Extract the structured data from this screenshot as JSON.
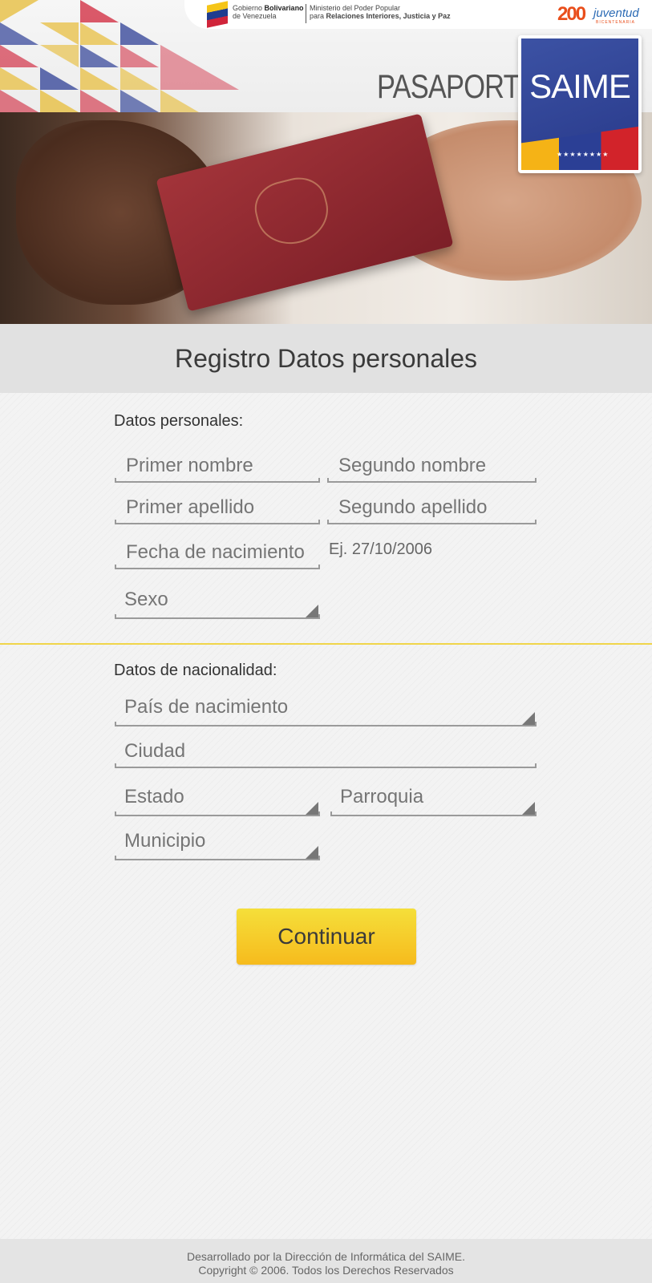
{
  "header": {
    "gov_line1_bold": "Bolivariano",
    "gov_line1_prefix": "Gobierno",
    "gov_line2": "de Venezuela",
    "ministry_line1": "Ministerio del Poder Popular",
    "ministry_line2_prefix": "para",
    "ministry_line2_bold": "Relaciones Interiores, Justicia y Paz",
    "juventud_number": "200",
    "juventud_word": "juventud",
    "juventud_sub": "BICENTENARIA",
    "pasaporte": "PASAPORTE",
    "saime": "SAIME",
    "saime_stars": "★★★★★★★★",
    "colors": {
      "saime_blue": "#2d3f95",
      "flag_yellow": "#f5c518",
      "flag_blue": "#1f3c8f",
      "flag_red": "#d0243a"
    }
  },
  "page": {
    "title": "Registro Datos personales"
  },
  "personal": {
    "section_label": "Datos personales:",
    "first_name_placeholder": "Primer nombre",
    "second_name_placeholder": "Segundo nombre",
    "first_surname_placeholder": "Primer apellido",
    "second_surname_placeholder": "Segundo apellido",
    "birth_date_placeholder": "Fecha de nacimiento",
    "birth_date_hint": "Ej. 27/10/2006",
    "sex_select": "Sexo"
  },
  "nationality": {
    "section_label": "Datos de nacionalidad:",
    "birth_country_select": "País de nacimiento",
    "city_placeholder": "Ciudad",
    "state_select": "Estado",
    "parish_select": "Parroquia",
    "municipality_select": "Municipio"
  },
  "actions": {
    "continue_label": "Continuar",
    "continue_color": "#f6c927"
  },
  "footer": {
    "line1": "Desarrollado por la Dirección de Informática del SAIME.",
    "line2": "Copyright © 2006. Todos los Derechos Reservados"
  }
}
